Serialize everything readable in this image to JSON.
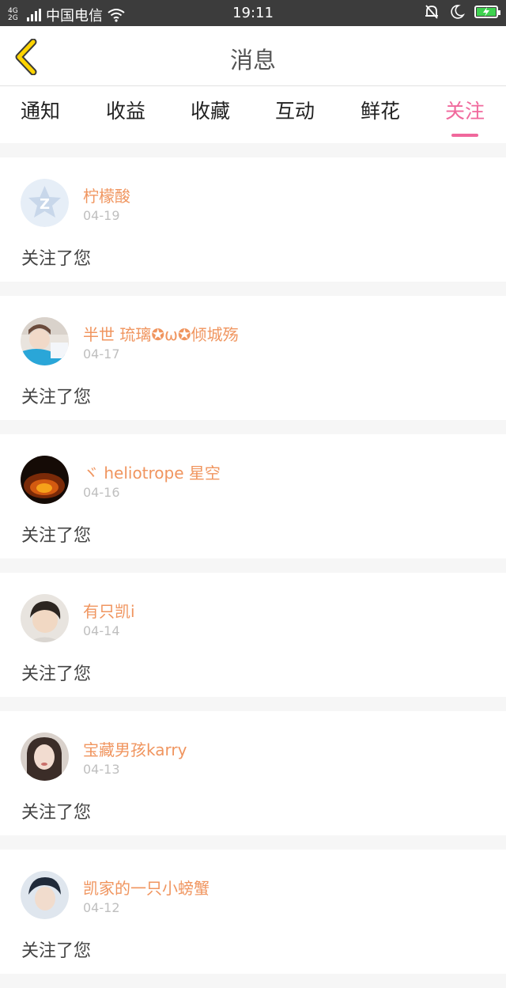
{
  "status_bar": {
    "network": "4G 2G",
    "carrier": "中国电信",
    "time": "19:11"
  },
  "header": {
    "title": "消息"
  },
  "tabs": [
    {
      "label": "通知",
      "active": false
    },
    {
      "label": "收益",
      "active": false
    },
    {
      "label": "收藏",
      "active": false
    },
    {
      "label": "互动",
      "active": false
    },
    {
      "label": "鲜花",
      "active": false
    },
    {
      "label": "关注",
      "active": true
    }
  ],
  "colors": {
    "accent_pink": "#f0689c",
    "name_orange": "#f0955f",
    "status_bar": "#3c3c3c",
    "back_arrow_yellow": "#ffd400"
  },
  "feed": [
    {
      "name": "柠檬酸",
      "date": "04-19",
      "message": "关注了您",
      "avatar": "default-qzone-avatar"
    },
    {
      "name": "半世 琉璃✪ω✪倾城殇",
      "date": "04-17",
      "message": "关注了您",
      "avatar": "photo-avatar"
    },
    {
      "name": "ヾ heliotrope 星空",
      "date": "04-16",
      "message": "关注了您",
      "avatar": "fire-text-avatar"
    },
    {
      "name": "有只凯i",
      "date": "04-14",
      "message": "关注了您",
      "avatar": "photo-avatar"
    },
    {
      "name": "宝藏男孩karry",
      "date": "04-13",
      "message": "关注了您",
      "avatar": "photo-avatar"
    },
    {
      "name": "凯家的一只小螃蟹",
      "date": "04-12",
      "message": "关注了您",
      "avatar": "photo-avatar"
    }
  ]
}
